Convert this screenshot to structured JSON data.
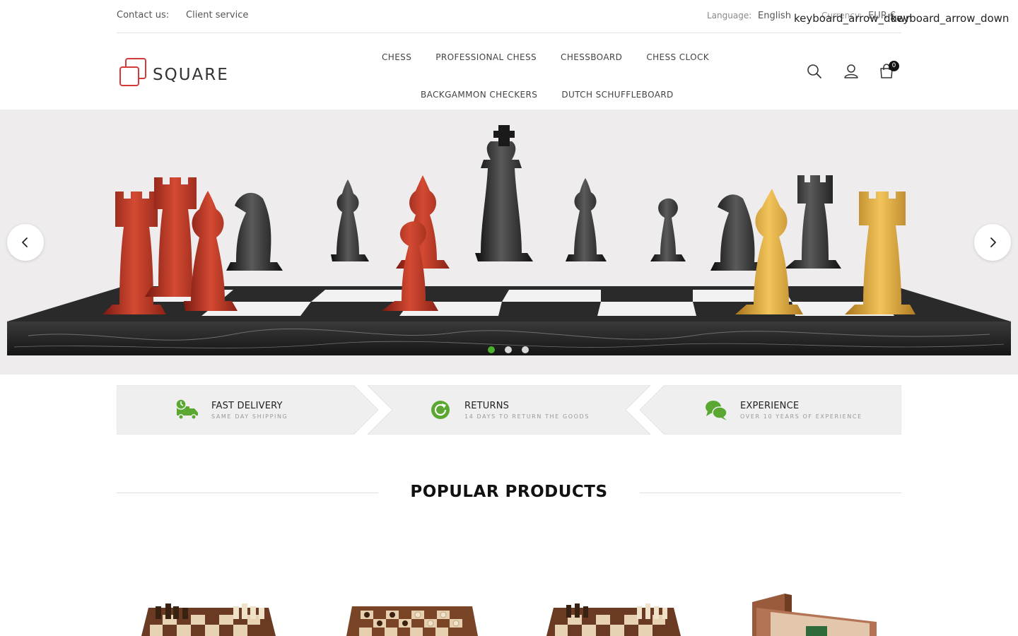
{
  "topbar": {
    "contact_label": "Contact us:",
    "client_service": "Client service",
    "language_label": "Language:",
    "language_value": "English",
    "currency_label": "Currency:",
    "currency_value": "EUR €",
    "arrow_text_1": "keyboard_arrow_down",
    "arrow_text_2": "keyboard_arrow_down"
  },
  "brand": {
    "name": "SQUARE",
    "accent": "#d33a3a"
  },
  "nav": {
    "row1": [
      "CHESS",
      "PROFESSIONAL CHESS",
      "CHESSBOARD",
      "CHESS CLOCK"
    ],
    "row2": [
      "BACKGAMMON CHECKERS",
      "DUTCH SCHUFFLEBOARD"
    ]
  },
  "header_icons": {
    "search": "search-icon",
    "account": "user-icon",
    "cart": "shopping-bag-icon",
    "cart_count": "0"
  },
  "slider": {
    "prev_icon": "chevron-left-icon",
    "next_icon": "chevron-right-icon",
    "dots": 3,
    "active_dot": 0,
    "active_color": "#4caf2e"
  },
  "features": [
    {
      "title": "FAST DELIVERY",
      "subtitle": "SAME DAY SHIPPING",
      "icon": "truck-icon"
    },
    {
      "title": "RETURNS",
      "subtitle": "14 DAYS TO RETURN THE GOODS",
      "icon": "refresh-icon"
    },
    {
      "title": "EXPERIENCE",
      "subtitle": "OVER 10 YEARS OF EXPERIENCE",
      "icon": "chat-bubbles-icon"
    }
  ],
  "feature_icon_color": "#5aa832",
  "popular": {
    "title": "POPULAR PRODUCTS"
  }
}
